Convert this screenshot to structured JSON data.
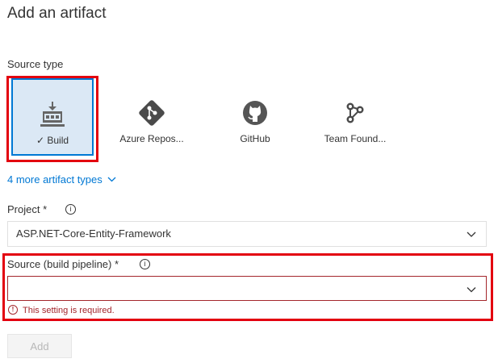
{
  "header": {
    "title": "Add an artifact"
  },
  "source_type": {
    "label": "Source type",
    "tiles": [
      {
        "label": "Build",
        "icon": "build-icon",
        "selected": true
      },
      {
        "label": "Azure Repos...",
        "icon": "git-icon",
        "selected": false
      },
      {
        "label": "GitHub",
        "icon": "github-icon",
        "selected": false
      },
      {
        "label": "Team Found...",
        "icon": "team-foundation-icon",
        "selected": false
      }
    ],
    "more_link": "4 more artifact types"
  },
  "project": {
    "label": "Project *",
    "value": "ASP.NET-Core-Entity-Framework"
  },
  "source": {
    "label": "Source (build pipeline) *",
    "value": "",
    "error": "This setting is required."
  },
  "actions": {
    "add_label": "Add"
  },
  "colors": {
    "accent": "#0078d4",
    "highlight_red": "#e3000f",
    "error": "#a4262c",
    "selected_bg": "#dbe8f5"
  }
}
